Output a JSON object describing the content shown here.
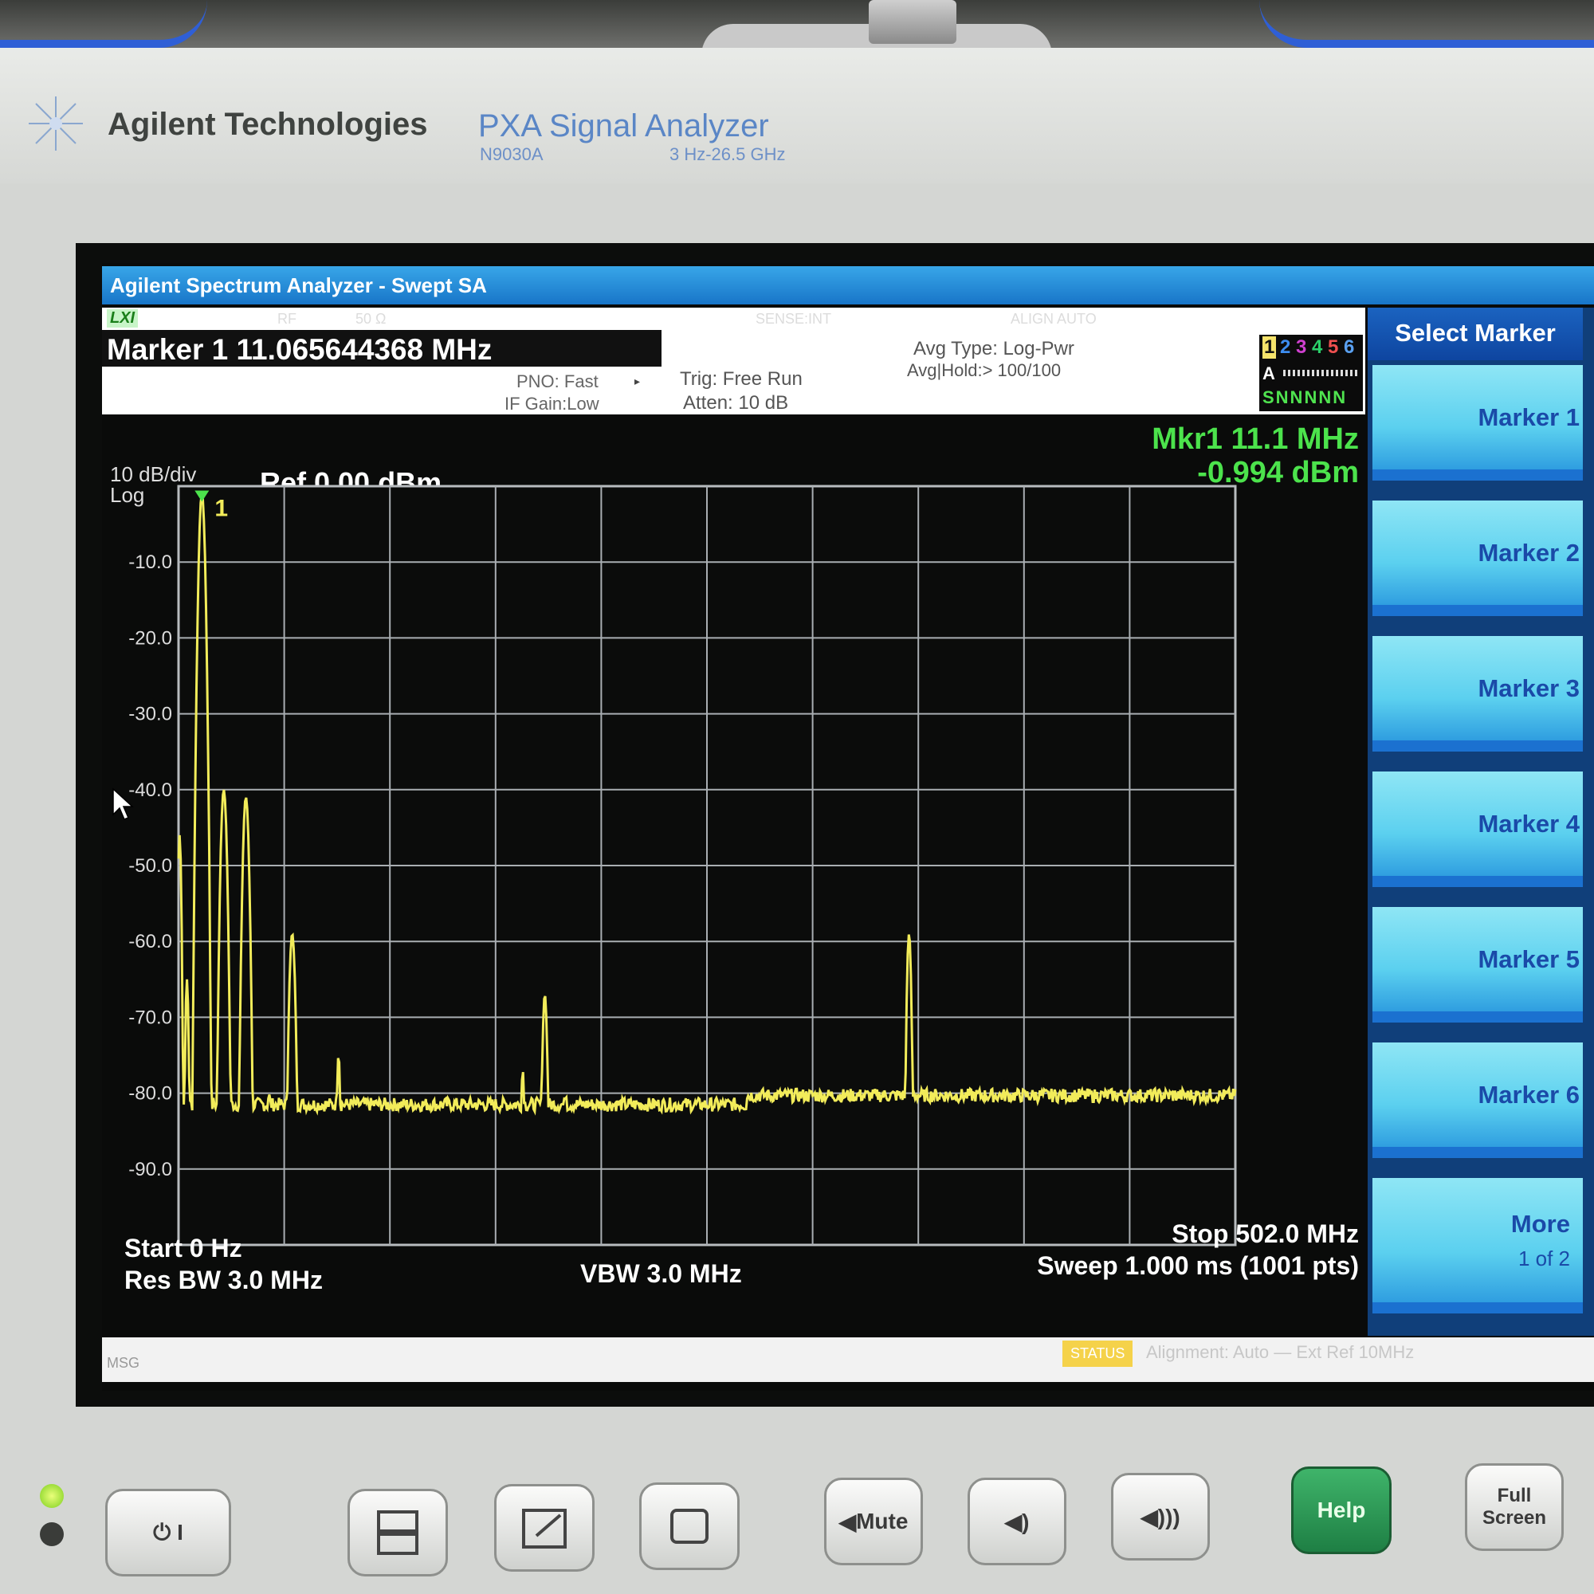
{
  "instrument": {
    "brand": "Agilent Technologies",
    "model": "PXA Signal Analyzer",
    "model_number": "N9030A",
    "freq_range": "3 Hz-26.5 GHz"
  },
  "window": {
    "title": "Agilent Spectrum Analyzer - Swept SA"
  },
  "header": {
    "lxi": "LXI",
    "marker_readout": "Marker 1 11.065644368 MHz",
    "pno": "PNO: Fast",
    "if_gain": "IF Gain:Low",
    "trig": "Trig: Free Run",
    "atten": "Atten: 10 dB",
    "avg_type": "Avg Type: Log-Pwr",
    "avg_hold": "Avg|Hold:> 100/100",
    "ghost_labels": [
      "RF",
      "50 Ω",
      "SENSE:INT",
      "ALIGN AUTO"
    ],
    "trace_numbers": [
      "1",
      "2",
      "3",
      "4",
      "5",
      "6"
    ],
    "trace_colors": [
      "#111111",
      "#3d8df0",
      "#d040d0",
      "#2bd06a",
      "#f05050",
      "#5aa0f0"
    ],
    "trace_type": "A",
    "trace_detectors": "SNNNNN"
  },
  "plot": {
    "scale": "10 dB/div",
    "scale_type": "Log",
    "ref_level": "Ref 0.00 dBm",
    "marker_label": "Mkr1 11.1 MHz",
    "marker_value": "-0.994 dBm",
    "marker_tag": "1",
    "start": "Start 0 Hz",
    "res_bw": "Res BW 3.0 MHz",
    "vbw": "VBW 3.0 MHz",
    "stop": "Stop 502.0 MHz",
    "sweep": "Sweep  1.000 ms (1001 pts)"
  },
  "chart_data": {
    "type": "line",
    "x_unit": "MHz",
    "y_unit": "dBm",
    "xlim": [
      0,
      502
    ],
    "ylim": [
      -100,
      0
    ],
    "y_ticks": [
      "-10.0",
      "-20.0",
      "-30.0",
      "-40.0",
      "-50.0",
      "-60.0",
      "-70.0",
      "-80.0",
      "-90.0"
    ],
    "grid": true,
    "noise_floor": -81.5,
    "peaks": [
      {
        "x": 0.5,
        "y": -46,
        "w": 1.8
      },
      {
        "x": 4.0,
        "y": -65,
        "w": 1.8
      },
      {
        "x": 11.1,
        "y": -0.994,
        "w": 3.2
      },
      {
        "x": 21.5,
        "y": -40,
        "w": 3.2
      },
      {
        "x": 32.0,
        "y": -41,
        "w": 3.2
      },
      {
        "x": 43.0,
        "y": -80,
        "w": 2.5
      },
      {
        "x": 54.0,
        "y": -59,
        "w": 3.2
      },
      {
        "x": 76.0,
        "y": -75,
        "w": 2.0
      },
      {
        "x": 163.5,
        "y": -77,
        "w": 2.0
      },
      {
        "x": 174.0,
        "y": -67,
        "w": 2.6
      },
      {
        "x": 184.0,
        "y": -80,
        "w": 2.0
      },
      {
        "x": 347.0,
        "y": -59,
        "w": 2.4
      },
      {
        "x": 379.0,
        "y": -80,
        "w": 2.5
      }
    ],
    "troughs": [
      {
        "x": 16.2,
        "y": -74
      },
      {
        "x": 26.8,
        "y": -77
      }
    ]
  },
  "softkeys": {
    "title": "Select Marker",
    "items": [
      "Marker 1",
      "Marker 2",
      "Marker 3",
      "Marker 4",
      "Marker 5",
      "Marker 6"
    ],
    "more": "More",
    "more_page": "1 of 2"
  },
  "status": {
    "msg": "MSG",
    "status_label": "STATUS",
    "status_text": "Alignment: Auto — Ext Ref 10MHz"
  },
  "hardware": {
    "mute": "Mute",
    "help": "Help",
    "full_screen_1": "Full",
    "full_screen_2": "Screen"
  }
}
